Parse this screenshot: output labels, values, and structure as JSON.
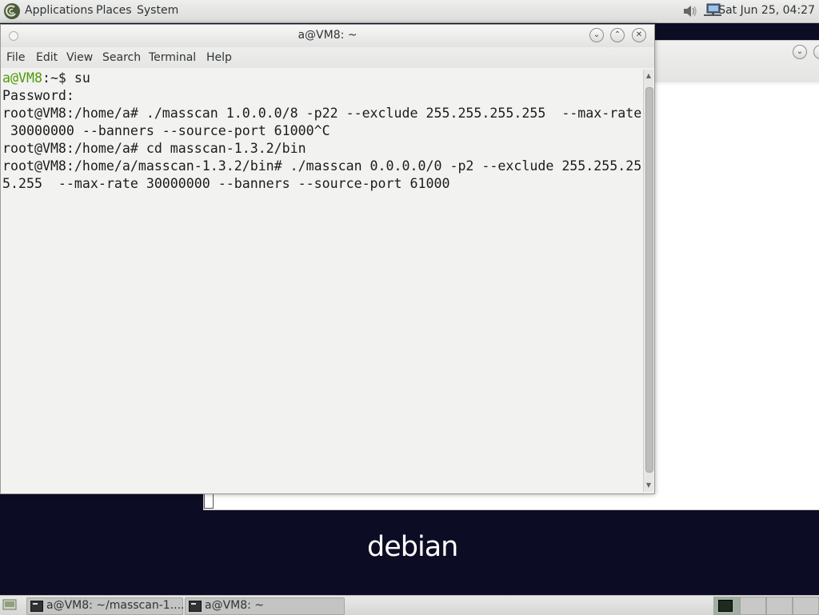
{
  "top_panel": {
    "menus": [
      "Applications",
      "Places",
      "System"
    ],
    "clock": "Sat Jun 25, 04:27"
  },
  "desktop": {
    "logo_text": "debian"
  },
  "terminal": {
    "title": "a@VM8: ~",
    "menu": [
      "File",
      "Edit",
      "View",
      "Search",
      "Terminal",
      "Help"
    ],
    "prompt_user_host": "a@VM8",
    "prompt_path": ":~$ ",
    "first_command": "su",
    "lines": [
      "Password:",
      "root@VM8:/home/a# ./masscan 1.0.0.0/8 -p22 --exclude 255.255.255.255  --max-rate",
      " 30000000 --banners --source-port 61000^C",
      "root@VM8:/home/a# cd masscan-1.3.2/bin",
      "root@VM8:/home/a/masscan-1.3.2/bin# ./masscan 0.0.0.0/0 -p2 --exclude 255.255.25",
      "5.255  --max-rate 30000000 --banners --source-port 61000"
    ]
  },
  "taskbar": {
    "tasks": [
      "a@VM8: ~/masscan-1....",
      "a@VM8: ~"
    ]
  }
}
